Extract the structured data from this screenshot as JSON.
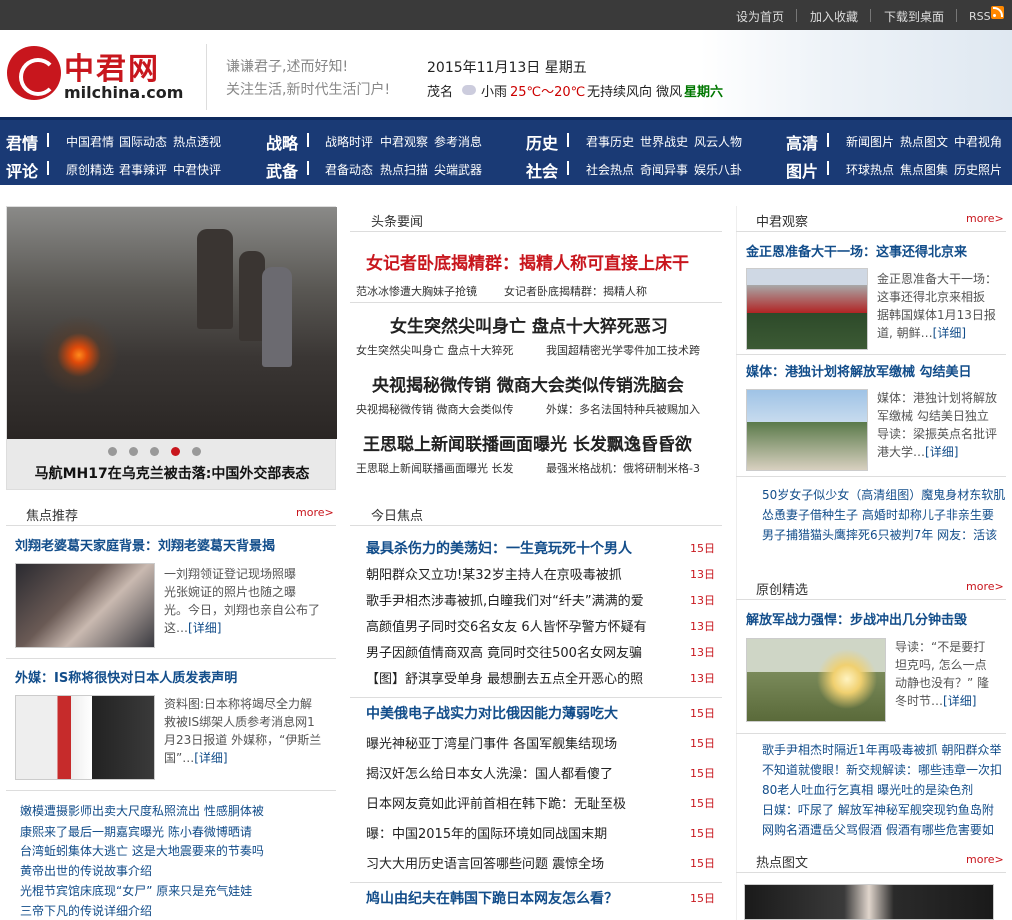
{
  "topbar": {
    "set_home": "设为首页",
    "favorite": "加入收藏",
    "download": "下载到桌面",
    "rss": "RSS"
  },
  "header": {
    "logo_text": "中君网",
    "logo_domain": "milchina.com",
    "slogan_1": "谦谦君子,述而好知!",
    "slogan_2": "关注生活,新时代生活门户!",
    "date": "2015年11月13日  星期五",
    "weather_city": "茂名",
    "weather_desc": "小雨",
    "weather_temp": "25℃～20℃",
    "weather_wind": "无持续风向  微风",
    "weather_day": "星期六"
  },
  "nav": {
    "row1": [
      {
        "head": "君情",
        "items": [
          "中国君情",
          "国际动态",
          "热点透视"
        ]
      },
      {
        "head": "战略",
        "items": [
          "战略时评",
          "中君观察",
          "参考消息"
        ]
      },
      {
        "head": "历史",
        "items": [
          "君事历史",
          "世界战史",
          "风云人物"
        ]
      },
      {
        "head": "高清",
        "items": [
          "新闻图片",
          "热点图文",
          "中君视角"
        ]
      }
    ],
    "row2": [
      {
        "head": "评论",
        "items": [
          "原创精选",
          "君事辣评",
          "中君快评"
        ]
      },
      {
        "head": "武备",
        "items": [
          "君备动态",
          "热点扫描",
          "尖端武器"
        ]
      },
      {
        "head": "社会",
        "items": [
          "社会热点",
          "奇闻异事",
          "娱乐八卦"
        ]
      },
      {
        "head": "图片",
        "items": [
          "环球热点",
          "焦点图集",
          "历史照片"
        ]
      }
    ]
  },
  "slider": {
    "caption": "马航MH17在乌克兰被击落:中国外交部表态"
  },
  "focus": {
    "title": "焦点推荐",
    "more": "more>",
    "story1": {
      "title": "刘翔老婆葛天家庭背景：刘翔老婆葛天背景揭",
      "desc": [
        "一刘翔领证登记现场照曝",
        "光张婉证的照片也随之曝",
        "光。今日，刘翔也亲自公布了",
        "这…"
      ],
      "detail": "[详细]"
    },
    "story2": {
      "title": "外媒：IS称将很快对日本人质发表声明",
      "desc": [
        "资料图:日本称将竭尽全力解",
        "救被IS绑架人质参考消息网1",
        "月23日报道 外媒称，“伊斯兰",
        "国”…"
      ],
      "detail": "[详细]"
    },
    "links": [
      "嫩模遭摄影师出卖大尺度私照流出 性感胴体被",
      "康熙来了最后一期嘉宾曝光 陈小春微博晒请",
      "台湾蚯蚓集体大逃亡 这是大地震要来的节奏吗",
      "黄帝出世的传说故事介绍",
      "光棍节宾馆床底现“女尸” 原来只是充气娃娃",
      "三帝下凡的传说详细介绍"
    ]
  },
  "headlines": {
    "title": "头条要闻",
    "items": [
      {
        "main": "女记者卧底揭精群：揭精人称可直接上床干",
        "subs": [
          "范冰冰惨遭大胸妹子抢镜",
          "女记者卧底揭精群：揭精人称"
        ]
      },
      {
        "main": "女生突然尖叫身亡 盘点十大猝死恶习",
        "subs": [
          "女生突然尖叫身亡 盘点十大猝死",
          "我国超精密光学零件加工技术跨"
        ]
      },
      {
        "main": "央视揭秘微传销 微商大会类似传销洗脑会",
        "subs": [
          "央视揭秘微传销 微商大会类似传",
          "外媒：多名法国特种兵被赐加入"
        ]
      },
      {
        "main": "王思聪上新闻联播画面曝光 长发飘逸昏昏欲",
        "subs": [
          "王思聪上新闻联播画面曝光 长发",
          "最强米格战机：俄将研制米格-3"
        ]
      }
    ]
  },
  "today": {
    "title": "今日焦点",
    "rows": [
      {
        "text": "最具杀伤力的美荡妇：一生竟玩死十个男人",
        "date": "15日",
        "lead": true
      },
      {
        "text": "朝阳群众又立功!某32岁主持人在京吸毒被抓",
        "date": "13日",
        "lead": false
      },
      {
        "text": "歌手尹相杰涉毒被抓,白瞳我们对“纤夫”满满的爱",
        "date": "13日",
        "lead": false
      },
      {
        "text": "高颜值男子同时交6名女友  6人皆怀孕警方怀疑有",
        "date": "13日",
        "lead": false
      },
      {
        "text": "男子因颜值情商双高  竟同时交往500名女网友骗",
        "date": "13日",
        "lead": false
      },
      {
        "text": "【图】舒淇享受单身  最想删去五点全开恶心的照",
        "date": "13日",
        "lead": false
      },
      {
        "text": "中美俄电子战实力对比俄因能力薄弱吃大",
        "date": "15日",
        "lead": true
      },
      {
        "text": "曝光神秘亚丁湾星门事件  各国军舰集结现场",
        "date": "15日",
        "lead": false
      },
      {
        "text": "揭汉奸怎么给日本女人洗澡：国人都看傻了",
        "date": "15日",
        "lead": false
      },
      {
        "text": "日本网友竟如此评前首相在韩下跪：无耻至极",
        "date": "15日",
        "lead": false
      },
      {
        "text": "曝：中国2015年的国际环境如同战国末期",
        "date": "15日",
        "lead": false
      },
      {
        "text": "习大大用历史语言回答哪些问题  震惊全场",
        "date": "15日",
        "lead": false
      },
      {
        "text": "鸠山由纪夫在韩国下跪日本网友怎么看？",
        "date": "15日",
        "lead": true
      }
    ]
  },
  "observe": {
    "title": "中君观察",
    "more": "more>",
    "story1": {
      "title": "金正恩准备大干一场：这事还得北京来",
      "desc": [
        "金正恩准备大干一场：",
        "这事还得北京来相扳",
        "据韩国媒体1月13日报",
        "道, 朝鲜…"
      ],
      "detail": "[详细]"
    },
    "story2": {
      "title": "媒体：港独计划将解放军缴械 勾结美日",
      "desc": [
        "媒体：港独计划将解放",
        "军缴械  勾结美日独立",
        "导读：梁振英点名批评",
        "港大学…"
      ],
      "detail": "[详细]"
    },
    "links": [
      "50岁女子似少女（高清组图）魔鬼身材东软肌",
      "怂恿妻子借种生子 高婚时却称儿子非亲生要",
      "男子捕猎猫头鹰摔死6只被判7年 网友：活该"
    ]
  },
  "original": {
    "title": "原创精选",
    "more": "more>",
    "story1": {
      "title": "解放军战力强悍：步战冲出几分钟击毁",
      "desc": [
        "导读：“不是要打",
        "坦克吗, 怎么一点",
        "动静也没有？” 隆",
        "冬时节…"
      ],
      "detail": "[详细]"
    },
    "links": [
      "歌手尹相杰时隔近1年再吸毒被抓 朝阳群众举",
      "不知道就傻眼！新交规解读：哪些违章一次扣",
      "80老人吐血行乞真相 曝光吐的是染色剂",
      "日媒：吓尿了 解放军神秘军舰突现钓鱼岛附",
      "网购名酒遭岳父骂假酒 假酒有哪些危害要如"
    ]
  },
  "hotpic": {
    "title": "热点图文",
    "more": "more>"
  },
  "colors": {
    "brand_red": "#c8161d",
    "nav_blue": "#1a3a75",
    "link_blue": "#124d8a",
    "topbar": "#3a3a3a"
  }
}
